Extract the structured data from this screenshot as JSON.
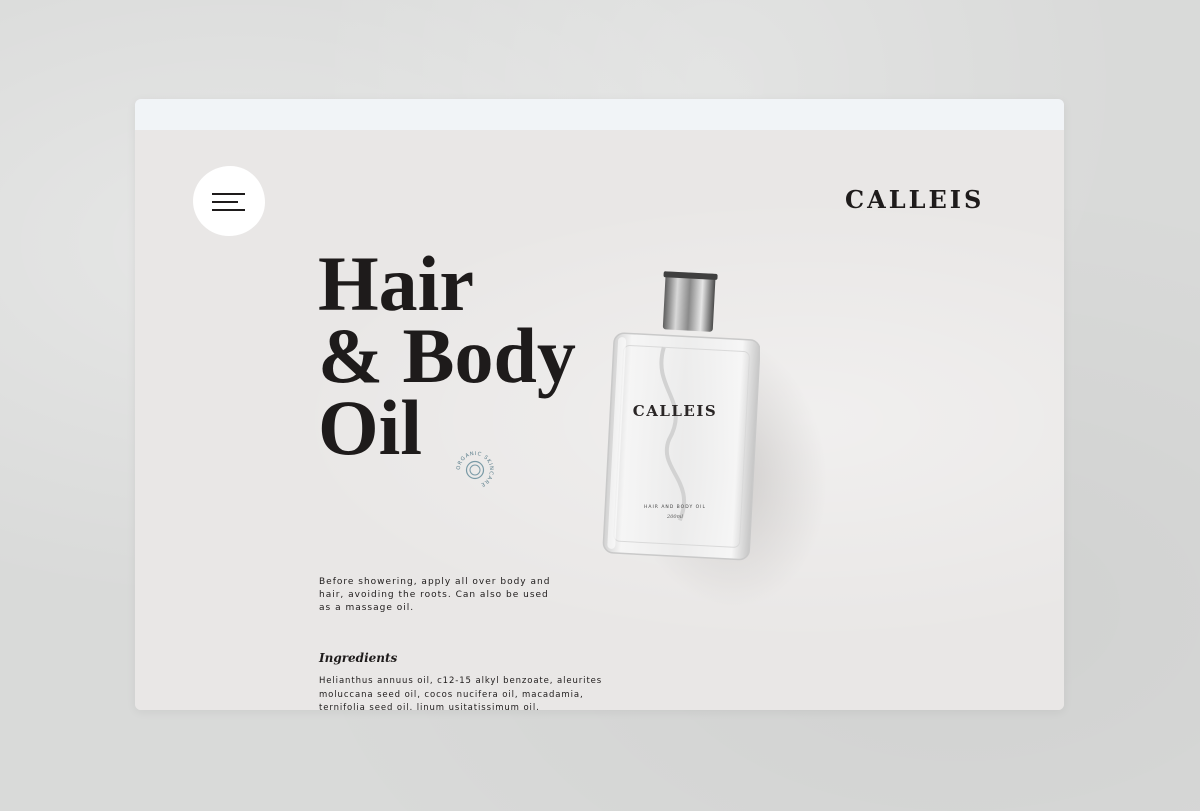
{
  "header": {
    "menu_icon": "hamburger-menu-icon",
    "brand": "CALLEIS"
  },
  "hero": {
    "title_lines": [
      "Hair",
      "& Body",
      "Oil"
    ],
    "seal_text": "ORGANIC SKINCARE",
    "seal_icon": "organic-skincare-seal-icon"
  },
  "product": {
    "brand": "CALLEIS",
    "name": "HAIR AND BODY OIL",
    "volume": "200ml"
  },
  "description": "Before showering, apply all over body and hair, avoiding the roots. Can also be used as a massage oil.",
  "ingredients": {
    "title": "Ingredients",
    "text": "Helianthus annuus oil, c12-15 alkyl benzoate, aleurites moluccana seed oil, cocos nucifera oil, macadamia, ternifolia seed oil, linum usitatissimum oil."
  },
  "colors": {
    "background": "#d9dad9",
    "page": "#e9e7e6",
    "browser_bar": "#f1f4f7",
    "text": "#1e1b1b",
    "seal_accent": "#7a9aa6"
  }
}
